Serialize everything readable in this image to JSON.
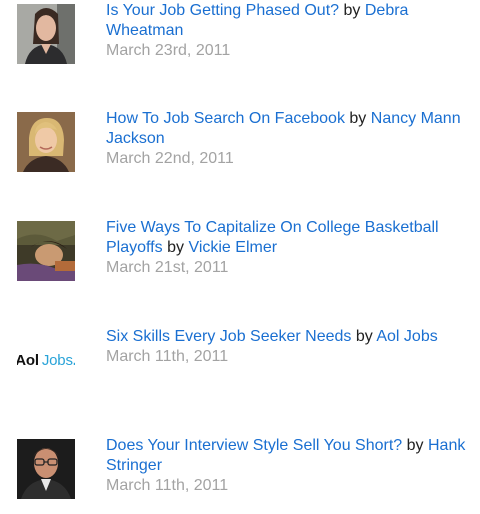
{
  "articles": [
    {
      "title": "Is Your Job Getting Phased Out?",
      "by": "by",
      "author": "Debra Wheatman",
      "date": "March 23rd, 2011",
      "thumbnail": "woman-portrait-dark-hair"
    },
    {
      "title": "How To Job Search On Facebook",
      "by": "by",
      "author": "Nancy Mann Jackson",
      "date": "March 22nd, 2011",
      "thumbnail": "woman-portrait-blonde"
    },
    {
      "title": "Five Ways To Capitalize On College Basketball Playoffs",
      "by": "by",
      "author": "Vickie Elmer",
      "date": "March 21st, 2011",
      "thumbnail": "woman-lying-photo"
    },
    {
      "title": "Six Skills Every Job Seeker Needs",
      "by": "by",
      "author": "Aol Jobs",
      "date": "March 11th, 2011",
      "thumbnail": "aol-jobs-logo",
      "logo": {
        "brand": "Aol",
        "product": "Jobs",
        "dot": "."
      }
    },
    {
      "title": "Does Your Interview Style Sell You Short?",
      "by": "by",
      "author": "Hank Stringer",
      "date": "March 11th, 2011",
      "thumbnail": "man-portrait-glasses"
    }
  ],
  "colors": {
    "link": "#1a6fd1",
    "text": "#222222",
    "date": "#a3a3a3",
    "aol_jobs_blue": "#29a3d8"
  }
}
